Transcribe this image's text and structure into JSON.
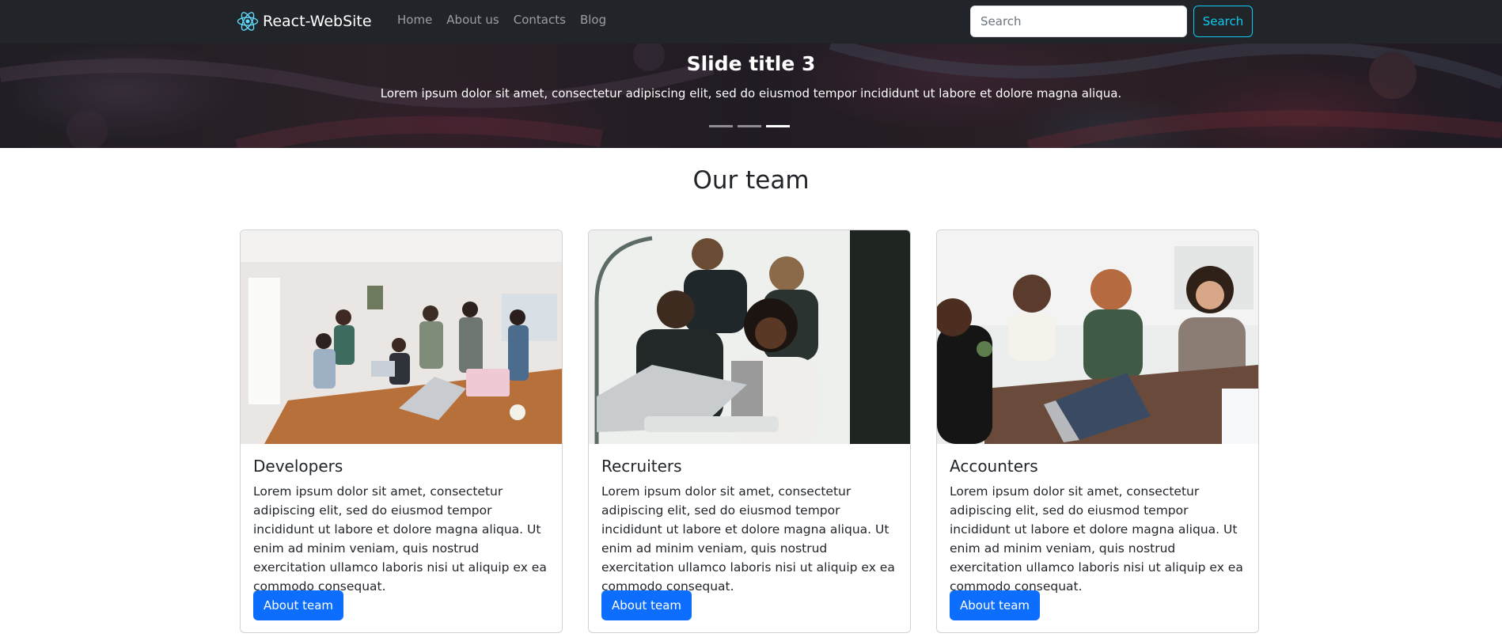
{
  "navbar": {
    "brand": "React-WebSite",
    "links": [
      "Home",
      "About us",
      "Contacts",
      "Blog"
    ],
    "search_placeholder": "Search",
    "search_button": "Search"
  },
  "carousel": {
    "title": "Slide title 3",
    "text": "Lorem ipsum dolor sit amet, consectetur adipiscing elit, sed do eiusmod tempor incididunt ut labore et dolore magna aliqua.",
    "slide_count": 3,
    "active_slide": 3
  },
  "section": {
    "title": "Our team"
  },
  "cards": [
    {
      "title": "Developers",
      "text": "Lorem ipsum dolor sit amet, consectetur adipiscing elit, sed do eiusmod tempor incididunt ut labore et dolore magna aliqua. Ut enim ad minim veniam, quis nostrud exercitation ullamco laboris nisi ut aliquip ex ea commodo consequat.",
      "button": "About team"
    },
    {
      "title": "Recruiters",
      "text": "Lorem ipsum dolor sit amet, consectetur adipiscing elit, sed do eiusmod tempor incididunt ut labore et dolore magna aliqua. Ut enim ad minim veniam, quis nostrud exercitation ullamco laboris nisi ut aliquip ex ea commodo consequat.",
      "button": "About team"
    },
    {
      "title": "Accounters",
      "text": "Lorem ipsum dolor sit amet, consectetur adipiscing elit, sed do eiusmod tempor incididunt ut labore et dolore magna aliqua. Ut enim ad minim veniam, quis nostrud exercitation ullamco laboris nisi ut aliquip ex ea commodo consequat.",
      "button": "About team"
    }
  ],
  "colors": {
    "navbar_bg": "#212529",
    "brand_icon": "#61dafb",
    "primary": "#0d6efd",
    "search_accent": "#0dcaf0"
  },
  "icons": {
    "brand": "react-atom-icon"
  }
}
